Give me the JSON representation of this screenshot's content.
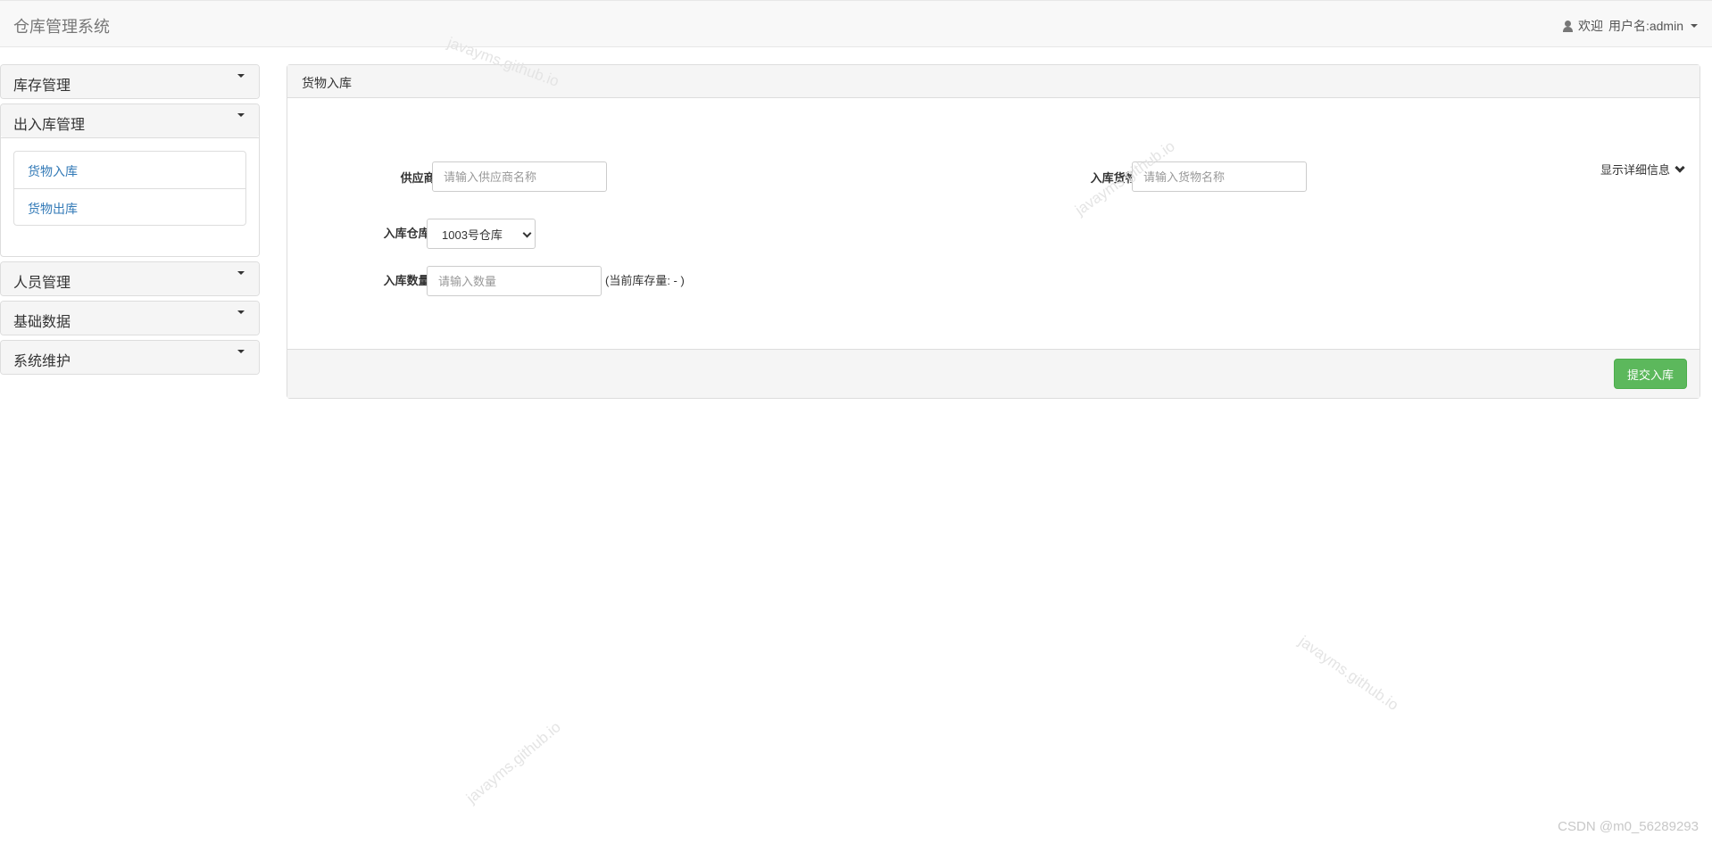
{
  "navbar": {
    "brand": "仓库管理系统",
    "welcome": "欢迎",
    "username": "用户名:admin"
  },
  "sidebar": {
    "panels": [
      {
        "label": "库存管理"
      },
      {
        "label": "出入库管理",
        "items": [
          {
            "label": "货物入库"
          },
          {
            "label": "货物出库"
          }
        ]
      },
      {
        "label": "人员管理"
      },
      {
        "label": "基础数据"
      },
      {
        "label": "系统维护"
      }
    ]
  },
  "main": {
    "title": "货物入库",
    "supplier": {
      "label": "供应商:",
      "placeholder": "请输入供应商名称"
    },
    "goods": {
      "label": "入库货物:",
      "placeholder": "请输入货物名称"
    },
    "detail_toggle": "显示详细信息",
    "warehouse": {
      "label": "入库仓库:",
      "selected": "1003号仓库"
    },
    "quantity": {
      "label": "入库数量:",
      "placeholder": "请输入数量"
    },
    "stock_note": "(当前库存量:  - )",
    "submit_label": "提交入库"
  },
  "watermarks": {
    "text": "javayms.github.io",
    "credit": "CSDN @m0_56289293"
  }
}
